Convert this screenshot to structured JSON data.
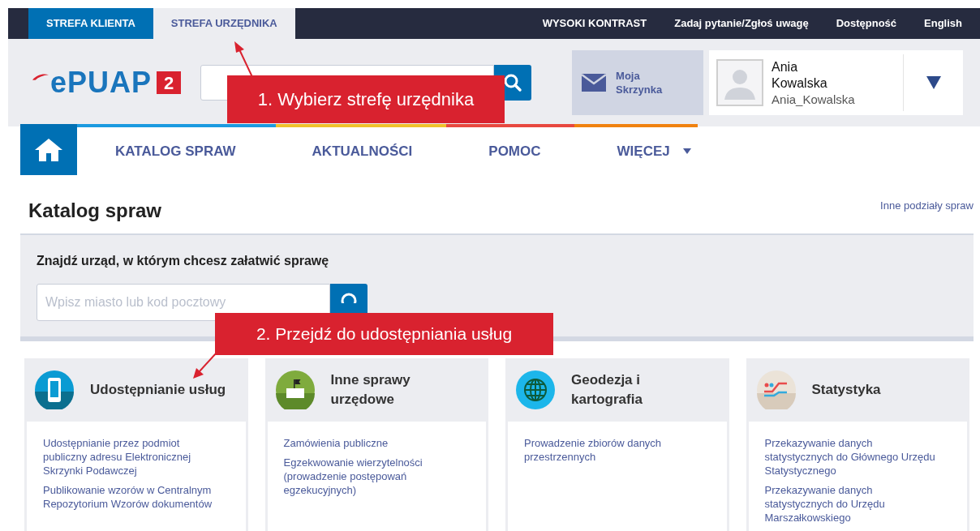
{
  "top_bar": {
    "zone_tabs": [
      {
        "label": "STREFA KLIENTA",
        "selected": false
      },
      {
        "label": "STREFA URZĘDNIKA",
        "selected": true
      }
    ],
    "links": [
      "WYSOKI KONTRAST",
      "Zadaj pytanie/Zgłoś uwagę",
      "Dostępność",
      "English"
    ]
  },
  "header": {
    "logo": {
      "text": "ePUAP",
      "badge": "2"
    },
    "mailbox": "Moja Skrzynka",
    "user": {
      "name": "Ania Kowalska",
      "login": "Ania_Kowalska"
    }
  },
  "nav": {
    "items": [
      {
        "label": "KATALOG SPRAW",
        "dropdown": false
      },
      {
        "label": "AKTUALNOŚCI",
        "dropdown": false
      },
      {
        "label": "POMOC",
        "dropdown": false
      },
      {
        "label": "WIĘCEJ",
        "dropdown": true
      }
    ]
  },
  "page": {
    "title": "Katalog spraw",
    "side_link": "Inne podziały spraw",
    "finder": {
      "heading": "Znajdź urząd, w którym chcesz załatwić sprawę",
      "placeholder": "Wpisz miasto lub kod pocztowy"
    },
    "categories": [
      {
        "kind": "phone",
        "title": "Udostępnianie usług",
        "links": [
          "Udostępnianie przez podmiot publiczny adresu Elektronicznej Skrzynki Podawczej",
          "Publikowanie wzorów w Centralnym Repozytorium Wzorów dokumentów"
        ]
      },
      {
        "kind": "office",
        "title": "Inne sprawy urzędowe",
        "links": [
          "Zamówienia publiczne",
          "Egzekwowanie wierzytelności (prowadzenie postępowań egzekucyjnych)"
        ]
      },
      {
        "kind": "globe",
        "title": "Geodezja i kartografia",
        "links": [
          "Prowadzenie zbiorów danych przestrzennych"
        ]
      },
      {
        "kind": "stats",
        "title": "Statystyka",
        "links": [
          "Przekazywanie danych statystycznych do Głównego Urzędu Statystycznego",
          "Przekazywanie danych statystycznych do Urzędu Marszałkowskiego"
        ]
      }
    ]
  },
  "callouts": [
    {
      "text": "1. Wybierz strefę urzędnika"
    },
    {
      "text": "2. Przejdź do udostępniania usług"
    }
  ]
}
